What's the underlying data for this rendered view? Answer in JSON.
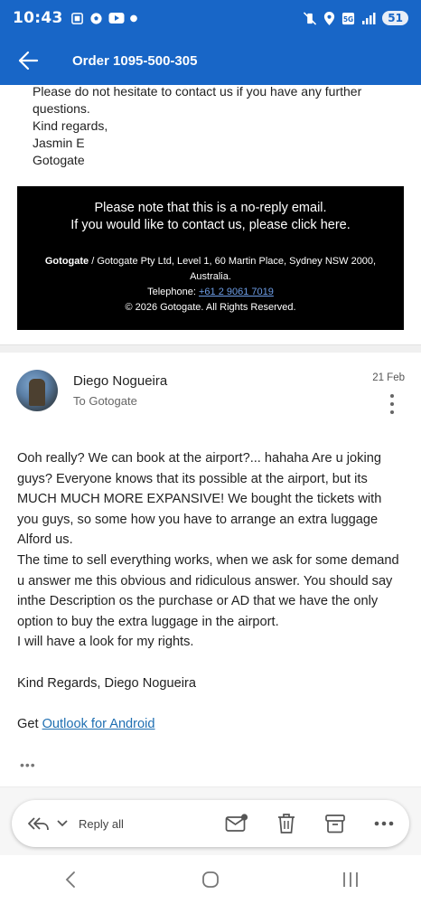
{
  "status_bar": {
    "time": "10:43",
    "battery": "51"
  },
  "app_bar": {
    "title": "Order 1095-500-305"
  },
  "previous_message": {
    "lines": [
      "Please do not hesitate to contact us if you have any further",
      "questions.",
      "Kind regards,",
      "Jasmin E",
      "Gotogate"
    ]
  },
  "footer_box": {
    "note_line1": "Please note that this is a no-reply email.",
    "note_line2": "If you would like to contact us, please click here.",
    "company_bold": "Gotogate",
    "company_rest": " / Gotogate Pty Ltd, Level 1, 60 Martin Place, Sydney NSW 2000, Australia.",
    "telephone_label": "Telephone: ",
    "telephone_number": "+61 2 9061 7019",
    "copyright": "© 2026 Gotogate. All Rights Reserved."
  },
  "message": {
    "sender_name": "Diego Nogueira",
    "recipient": "To Gotogate",
    "date": "21 Feb",
    "paragraph1": "Ooh really? We can book at the airport?... hahaha Are u joking guys? Everyone knows that its possible at the airport, but its MUCH MUCH MORE EXPANSIVE! We bought the tickets with you guys, so some how you have to arrange an extra luggage Alford us.",
    "paragraph2": "The time to sell everything works, when we ask for some demand u answer me this obvious and ridiculous answer. You should say inthe Description os the purchase or AD that we have the only option to buy the extra luggage in the airport.",
    "paragraph3": "I will have a look for my rights.",
    "signature": "Kind Regards, Diego Nogueira",
    "get_prefix": "Get ",
    "get_link": "Outlook for Android",
    "more_label": "•••"
  },
  "action_bar": {
    "reply_all_label": "Reply all"
  },
  "colors": {
    "brand": "#1866c7",
    "link": "#1f6fb2",
    "footer_bg": "#000000"
  },
  "icons": {
    "back": "arrow-left-icon",
    "reply_all": "reply-all-icon",
    "chevron": "chevron-down-icon",
    "mark_unread": "mail-unread-icon",
    "delete": "trash-icon",
    "archive": "archive-icon",
    "more": "more-horizontal-icon",
    "nav_back": "nav-back-icon",
    "nav_home": "nav-home-icon",
    "nav_recents": "nav-recents-icon"
  }
}
